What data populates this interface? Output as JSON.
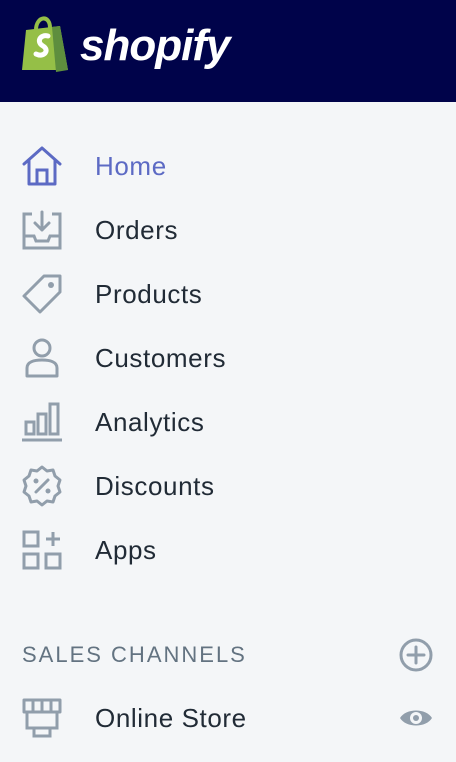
{
  "brand": {
    "name": "shopify",
    "colors": {
      "topbar": "#00034a",
      "bag": "#95bf47",
      "active": "#5c6ac4",
      "icon": "#919eab"
    }
  },
  "nav": {
    "items": [
      {
        "label": "Home",
        "icon": "home-icon",
        "active": true
      },
      {
        "label": "Orders",
        "icon": "orders-inbox-icon",
        "active": false
      },
      {
        "label": "Products",
        "icon": "tag-icon",
        "active": false
      },
      {
        "label": "Customers",
        "icon": "person-icon",
        "active": false
      },
      {
        "label": "Analytics",
        "icon": "bar-chart-icon",
        "active": false
      },
      {
        "label": "Discounts",
        "icon": "discount-badge-icon",
        "active": false
      },
      {
        "label": "Apps",
        "icon": "apps-grid-icon",
        "active": false
      }
    ]
  },
  "sales_channels": {
    "title": "SALES CHANNELS",
    "add_icon": "plus-circle-icon",
    "items": [
      {
        "label": "Online Store",
        "icon": "storefront-icon",
        "action_icon": "eye-icon"
      }
    ]
  }
}
